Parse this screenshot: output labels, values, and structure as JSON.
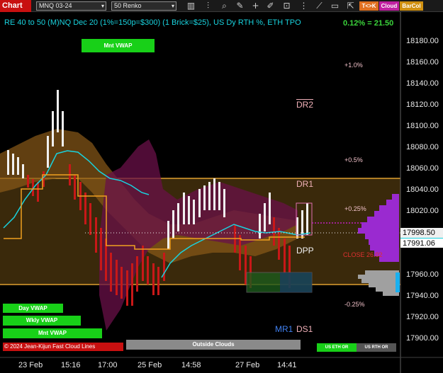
{
  "toolbar": {
    "chart_label": "Chart",
    "instrument": "MNQ 03-24",
    "bar_type": "50 Renko",
    "btn_tk": "T<>K",
    "btn_cloud": "Cloud",
    "btn_barcol": "BarCol",
    "icons": [
      "bars-icon",
      "zoom-icon",
      "tool-icon",
      "crosshair-icon",
      "draw-icon",
      "lock-icon",
      "dots-icon",
      "pen-icon",
      "window-icon",
      "export-icon",
      "expand-icon"
    ]
  },
  "chart": {
    "header": "RE 40 to 50 (M)NQ Dec 20 (1%=150p=$300) (1 Brick=$25), US Dy RTH %, ETH TPO",
    "pct_readout": "0.12% = 21.50",
    "price_ticks": [
      "18180.00",
      "18160.00",
      "18140.00",
      "18120.00",
      "18100.00",
      "18080.00",
      "18060.00",
      "18040.00",
      "18020.00",
      "17960.00",
      "17940.00",
      "17920.00",
      "17900.00"
    ],
    "current_price": "17998.50",
    "current_price_2": "17991.06",
    "time_ticks": [
      "23 Feb",
      "15:16",
      "17:00",
      "25 Feb",
      "14:58",
      "27 Feb",
      "14:41"
    ],
    "levels": {
      "dr2": "DR2",
      "dr1": "DR1",
      "dpp": "DPP",
      "close": "CLOSE 26.02",
      "mr1": "MR1",
      "ds1": "DS1"
    },
    "pct_labels": {
      "p1": "+1.0%",
      "p05": "+0.5%",
      "p025": "+0.25%",
      "m025": "-0.25%"
    },
    "buttons": {
      "mnt_vwap_top": "Mnt VWAP",
      "day_vwap": "Day VWAP",
      "wkly_vwap": "Wkly VWAP",
      "mnt_vwap": "Mnt VWAP",
      "outside_clouds": "Outside Clouds",
      "us_eth_or": "US ETH OR",
      "us_rth_or": "US RTH OR"
    },
    "copyright": "© 2024 Jean-Kijun Fast Cloud Lines",
    "colors": {
      "accent_red": "#c81010",
      "header_cyan": "#19d3df",
      "pct_green": "#3bd43b",
      "dr_band": "#c8962e",
      "tpo_purple": "#9a2ad0",
      "vwap_green": "#18d018"
    }
  }
}
